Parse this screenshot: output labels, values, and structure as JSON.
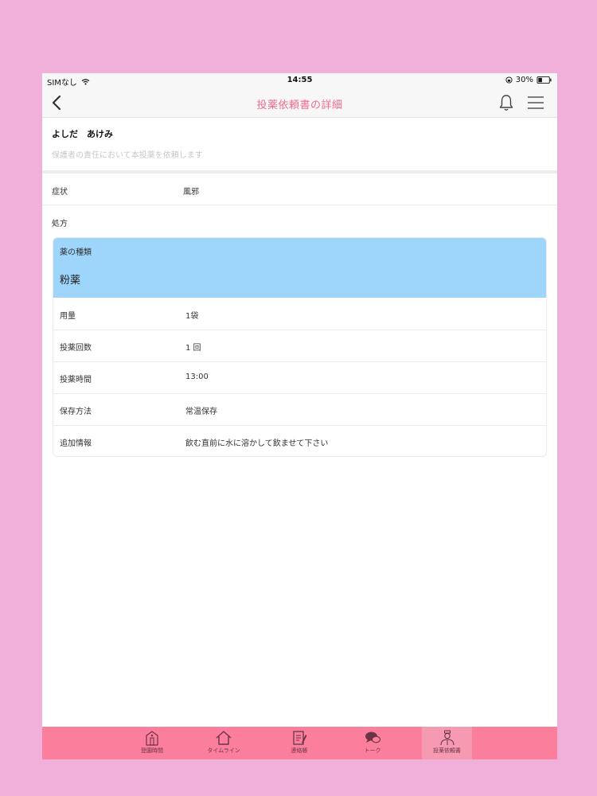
{
  "status_bar": {
    "carrier": "SIMなし",
    "time": "14:55",
    "battery": "30%"
  },
  "nav": {
    "title": "投薬依頼書の詳細"
  },
  "parent": {
    "name": "よしだ　あけみ",
    "note": "保護者の責任において本投薬を依頼します"
  },
  "symptom": {
    "label": "症状",
    "value": "風邪"
  },
  "prescription": {
    "label": "処方"
  },
  "medicine": {
    "type_label": "薬の種類",
    "type_value": "粉薬",
    "rows": [
      {
        "label": "用量",
        "value": "1袋"
      },
      {
        "label": "投薬回数",
        "value": "1 回"
      },
      {
        "label": "投薬時間",
        "value": "13:00"
      },
      {
        "label": "保存方法",
        "value": "常温保存"
      },
      {
        "label": "追加情報",
        "value": "飲む直前に水に溶かして飲ませて下さい"
      }
    ]
  },
  "tabs": [
    {
      "label": "登園時間",
      "icon": "building-icon"
    },
    {
      "label": "タイムライン",
      "icon": "home-icon"
    },
    {
      "label": "連絡帳",
      "icon": "notebook-icon"
    },
    {
      "label": "トーク",
      "icon": "chat-bubble-icon"
    },
    {
      "label": "投薬依頼書",
      "icon": "doctor-icon",
      "active": true
    }
  ],
  "colors": {
    "page_background": "#f0b0da",
    "accent_pink": "#f06a8e",
    "tab_bar": "#fb7e9c",
    "card_header_blue": "#9dd5fb"
  }
}
